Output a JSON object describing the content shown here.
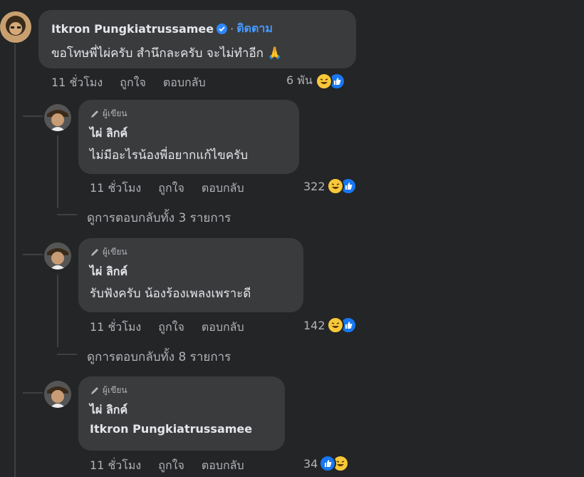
{
  "main_comment": {
    "author": "Itkron Pungkiatrussamee",
    "separator": "·",
    "follow_label": "ติดตาม",
    "text": "ขอโทษพี่ไผ่ครับ สำนึกละครับ จะไม่ทำอีก",
    "emoji": "🙏",
    "time": "11 ชั่วโมง",
    "like_label": "ถูกใจ",
    "reply_label": "ตอบกลับ",
    "reaction_count": "6 พัน"
  },
  "replies": [
    {
      "badge": "ผู้เขียน",
      "author": "ไผ่ ลิกค์",
      "text": "ไม่มีอะไรน้องพี่อยากแก้ไขครับ",
      "time": "11 ชั่วโมง",
      "like_label": "ถูกใจ",
      "reply_label": "ตอบกลับ",
      "reaction_count": "322",
      "view_replies": "ดูการตอบกลับทั้ง 3 รายการ"
    },
    {
      "badge": "ผู้เขียน",
      "author": "ไผ่ ลิกค์",
      "text": "รับฟังครับ น้องร้องเพลงเพราะดี",
      "time": "11 ชั่วโมง",
      "like_label": "ถูกใจ",
      "reply_label": "ตอบกลับ",
      "reaction_count": "142",
      "view_replies": "ดูการตอบกลับทั้ง 8 รายการ"
    },
    {
      "badge": "ผู้เขียน",
      "author": "ไผ่ ลิกค์",
      "text": "Itkron Pungkiatrussamee",
      "time": "11 ชั่วโมง",
      "like_label": "ถูกใจ",
      "reply_label": "ตอบกลับ",
      "reaction_count": "34"
    }
  ],
  "colors": {
    "background": "#242526",
    "bubble": "#3a3b3c",
    "link_blue": "#4599ff",
    "like_blue": "#1877f2"
  }
}
